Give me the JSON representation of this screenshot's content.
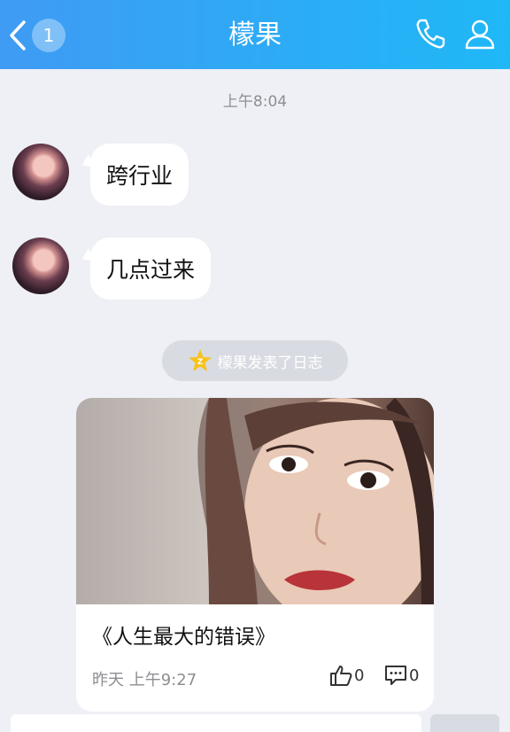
{
  "header": {
    "unread_count": "1",
    "title": "檬果",
    "icons": [
      "back-arrow-icon",
      "phone-icon",
      "contact-icon"
    ]
  },
  "chat": {
    "timestamp": "上午8:04",
    "messages": [
      {
        "text": "跨行业"
      },
      {
        "text": "几点过来"
      }
    ],
    "system_notice": "檬果发表了日志"
  },
  "post_card": {
    "title": "《人生最大的错误》",
    "time": "昨天 上午9:27",
    "like_count": "0",
    "comment_count": "0"
  },
  "colors": {
    "header_start": "#3f9bf3",
    "header_end": "#1fb8f7",
    "background": "#eef0f5"
  }
}
